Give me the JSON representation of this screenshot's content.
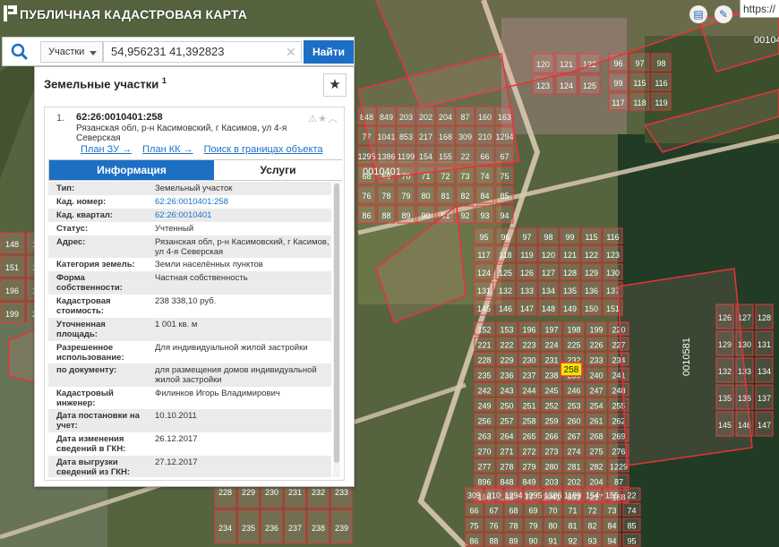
{
  "header": {
    "title": "ПУБЛИЧНАЯ КАДАСТРОВАЯ КАРТА",
    "url_fragment": "https://"
  },
  "search": {
    "type_selected": "Участки",
    "query": "54,956231 41,392823",
    "find_label": "Найти"
  },
  "results": {
    "heading": "Земельные участки",
    "count": "1",
    "item": {
      "index": "1.",
      "cad_number": "62:26:0010401:258",
      "address": "Рязанская обл, р-н Касимовский, г Касимов, ул 4-я Северская",
      "links": [
        "План ЗУ →",
        "План КК →",
        "Поиск в границах объекта →"
      ]
    },
    "tabs": [
      "Информация",
      "Услуги"
    ],
    "fields": [
      {
        "label": "Тип:",
        "value": "Земельный участок"
      },
      {
        "label": "Кад. номер:",
        "value": "62:26:0010401:258"
      },
      {
        "label": "Кад. квартал:",
        "value": "62:26:0010401"
      },
      {
        "label": "Статус:",
        "value": "Учтенный"
      },
      {
        "label": "Адрес:",
        "value": "Рязанская обл, р-н Касимовский, г Касимов, ул 4-я Северская"
      },
      {
        "label": "Категория земель:",
        "value": "Земли населённых пунктов"
      },
      {
        "label": "Форма собственности:",
        "value": "Частная собственность"
      },
      {
        "label": "Кадастровая стоимость:",
        "value": "238 338,10 руб."
      },
      {
        "label": "Уточненная площадь:",
        "value": "1 001 кв. м"
      },
      {
        "label": "Разрешенное использование:",
        "value": "Для индивидуальной жилой застройки"
      },
      {
        "label": "по документу:",
        "value": "для размещения домов индивидуальной жилой застройки"
      },
      {
        "label": "Кадастровый инженер:",
        "value": "Филинков Игорь Владимирович"
      },
      {
        "label": "Дата постановки на учет:",
        "value": "10.10.2011"
      },
      {
        "label": "Дата изменения сведений в ГКН:",
        "value": "26.12.2017"
      },
      {
        "label": "Дата выгрузки сведений из ГКН:",
        "value": "27.12.2017"
      }
    ]
  },
  "map": {
    "quarter_labels": [
      "0010401",
      "0010581",
      "001040"
    ],
    "parcel_labels": [
      "848",
      "849",
      "203",
      "202",
      "204",
      "87",
      "160",
      "163",
      "77",
      "1041",
      "853",
      "217",
      "168",
      "309",
      "210",
      "1294",
      "1295",
      "1386",
      "1199",
      "154",
      "155",
      "22",
      "66",
      "67",
      "68",
      "69",
      "70",
      "71",
      "72",
      "73",
      "74",
      "75",
      "76",
      "78",
      "79",
      "80",
      "81",
      "82",
      "84",
      "85",
      "86",
      "88",
      "89",
      "90",
      "91",
      "92",
      "93",
      "94",
      "95",
      "96",
      "97",
      "98",
      "99",
      "115",
      "116",
      "117",
      "118",
      "119",
      "120",
      "121",
      "122",
      "123",
      "124",
      "125",
      "126",
      "127",
      "128",
      "129",
      "130",
      "131",
      "132",
      "133",
      "134",
      "135",
      "136",
      "137",
      "145",
      "146",
      "147",
      "148",
      "149",
      "150",
      "151",
      "152",
      "153",
      "196",
      "197",
      "198",
      "199",
      "220",
      "221",
      "222",
      "223",
      "224",
      "225",
      "226",
      "227",
      "228",
      "229",
      "230",
      "231",
      "232",
      "233",
      "234",
      "235",
      "236",
      "237",
      "238",
      "239",
      "240",
      "241",
      "242",
      "243",
      "244",
      "245",
      "246",
      "247",
      "248",
      "249",
      "250",
      "251",
      "252",
      "253",
      "254",
      "255",
      "256",
      "257",
      "258",
      "259",
      "260",
      "261",
      "262",
      "263",
      "264",
      "265",
      "266",
      "267",
      "268",
      "269",
      "270",
      "271",
      "272",
      "273",
      "274",
      "275",
      "276",
      "277",
      "278",
      "279",
      "280",
      "281",
      "282",
      "1229",
      "896"
    ],
    "highlighted_parcel": "258",
    "colors": {
      "boundary": "#e8333a",
      "fill": "#f4a6a8",
      "highlight": "#f2e600",
      "accent": "#1c6fc4"
    }
  }
}
